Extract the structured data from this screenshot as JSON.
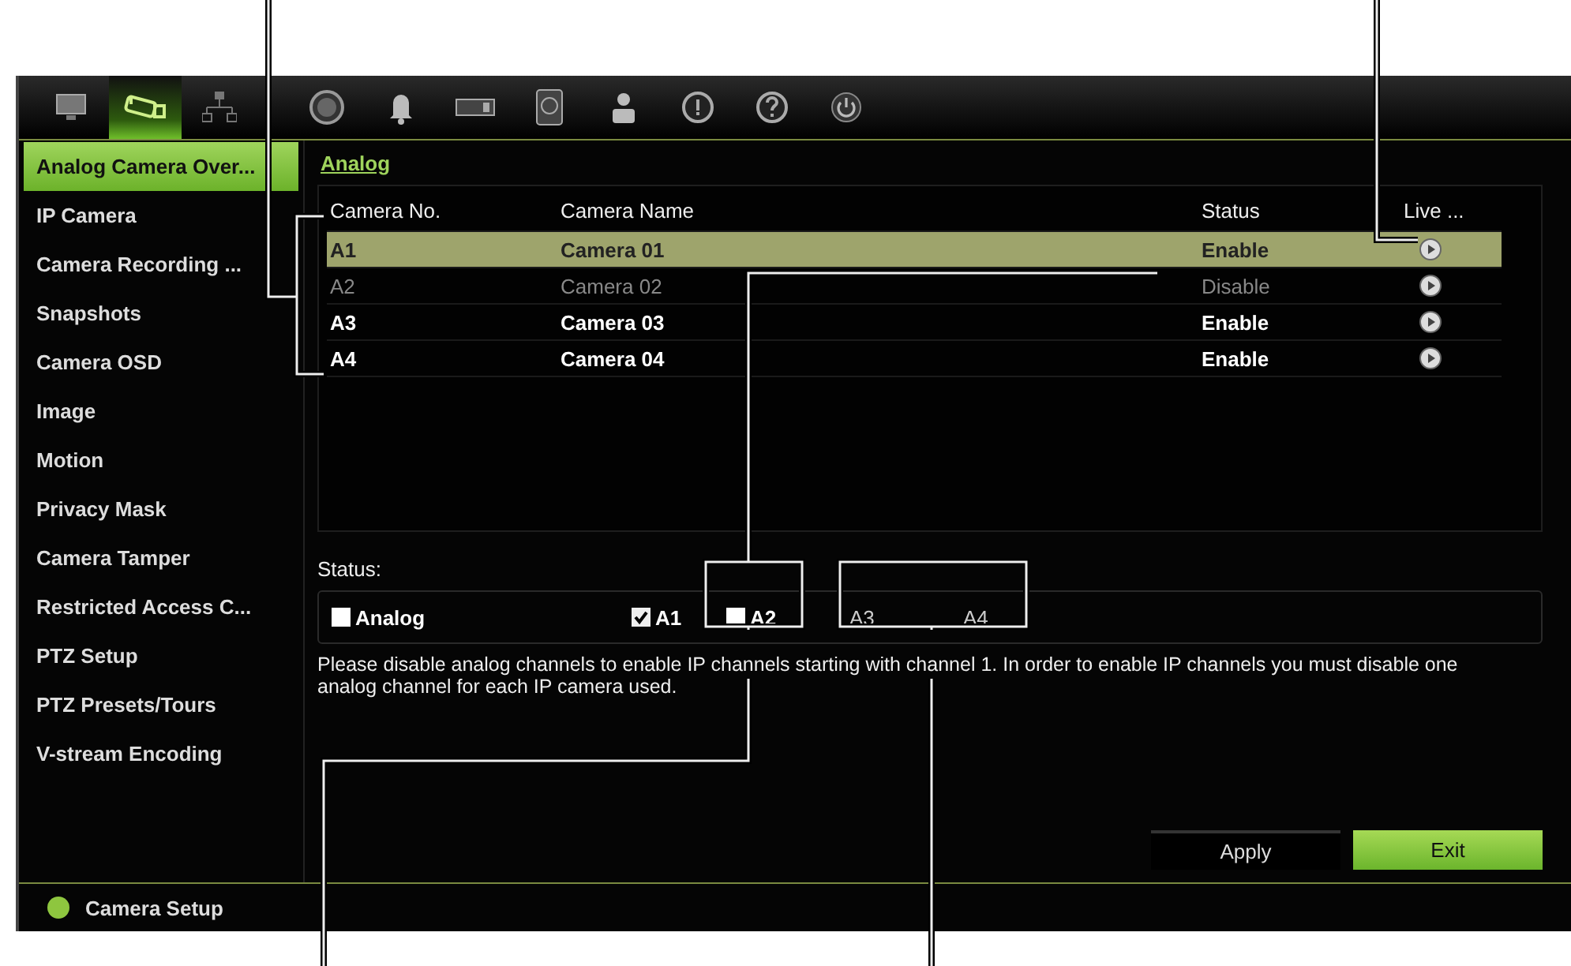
{
  "toolbar": [
    {
      "kind": "monitor",
      "selected": false
    },
    {
      "kind": "camera",
      "selected": true
    },
    {
      "kind": "network",
      "selected": false
    },
    {
      "kind": "record",
      "selected": false
    },
    {
      "kind": "bell",
      "selected": false
    },
    {
      "kind": "device",
      "selected": false
    },
    {
      "kind": "disk",
      "selected": false
    },
    {
      "kind": "user",
      "selected": false
    },
    {
      "kind": "info",
      "selected": false
    },
    {
      "kind": "help",
      "selected": false
    },
    {
      "kind": "power",
      "selected": false
    }
  ],
  "sidebar": {
    "items": [
      {
        "label": "Analog Camera Over...",
        "selected": true
      },
      {
        "label": "IP Camera",
        "selected": false
      },
      {
        "label": "Camera Recording ...",
        "selected": false
      },
      {
        "label": "Snapshots",
        "selected": false
      },
      {
        "label": "Camera OSD",
        "selected": false
      },
      {
        "label": "Image",
        "selected": false
      },
      {
        "label": "Motion",
        "selected": false
      },
      {
        "label": "Privacy Mask",
        "selected": false
      },
      {
        "label": "Camera Tamper",
        "selected": false
      },
      {
        "label": "Restricted Access C...",
        "selected": false
      },
      {
        "label": "PTZ Setup",
        "selected": false
      },
      {
        "label": "PTZ Presets/Tours",
        "selected": false
      },
      {
        "label": "V-stream Encoding",
        "selected": false
      }
    ]
  },
  "tabs": [
    {
      "label": "Analog",
      "selected": true
    }
  ],
  "table": {
    "columns": [
      "Camera No.",
      "Camera Name",
      "Status",
      "Live ..."
    ],
    "rows": [
      {
        "no": "A1",
        "name": "Camera 01",
        "status": "Enable",
        "enabled": true,
        "selected": true
      },
      {
        "no": "A2",
        "name": "Camera 02",
        "status": "Disable",
        "enabled": false,
        "selected": false
      },
      {
        "no": "A3",
        "name": "Camera 03",
        "status": "Enable",
        "enabled": true,
        "selected": false
      },
      {
        "no": "A4",
        "name": "Camera 04",
        "status": "Enable",
        "enabled": true,
        "selected": false
      }
    ]
  },
  "status": {
    "label": "Status:",
    "channels": [
      {
        "label": "Analog",
        "kind": "checkbox",
        "checked": false
      },
      {
        "label": "A1",
        "kind": "checkbox",
        "checked": true
      },
      {
        "label": "A2",
        "kind": "checkbox",
        "checked": false
      },
      {
        "label": "A3",
        "kind": "plain"
      },
      {
        "label": "A4",
        "kind": "plain"
      }
    ]
  },
  "note": "Please disable analog channels to enable IP channels starting with channel 1. In order to enable IP channels you must disable one analog channel for each IP camera used.",
  "buttons": [
    {
      "label": "Apply",
      "kind": "plain"
    },
    {
      "label": "Exit",
      "kind": "primary"
    }
  ],
  "status_bar": {
    "label": "Camera Setup"
  }
}
